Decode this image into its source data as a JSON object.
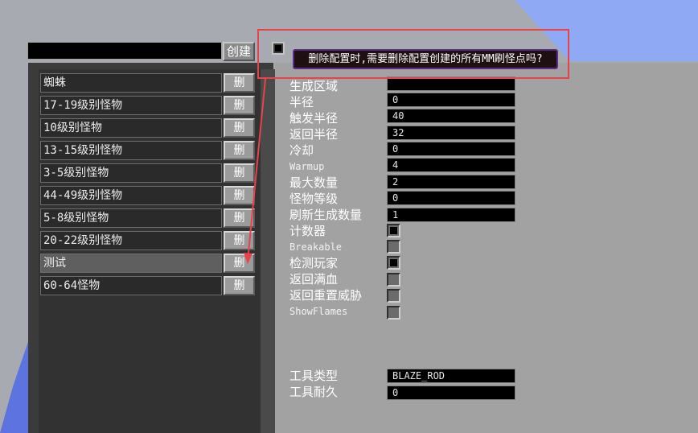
{
  "create_button": "创建",
  "name_input_value": "",
  "tooltip": "删除配置时,需要删除配置创建的所有MM刷怪点吗?",
  "delete_label": "删",
  "configs": [
    {
      "name": "蜘蛛",
      "selected": false
    },
    {
      "name": "17-19级别怪物",
      "selected": false
    },
    {
      "name": "10级别怪物",
      "selected": false
    },
    {
      "name": "13-15级别怪物",
      "selected": false
    },
    {
      "name": "3-5级别怪物",
      "selected": false
    },
    {
      "name": "44-49级别怪物",
      "selected": false
    },
    {
      "name": "5-8级别怪物",
      "selected": false
    },
    {
      "name": "20-22级别怪物",
      "selected": false
    },
    {
      "name": "测试",
      "selected": true
    },
    {
      "name": "60-64怪物",
      "selected": false
    }
  ],
  "fields": {
    "spawn_area": {
      "label": "生成区域",
      "value": ""
    },
    "radius": {
      "label": "半径",
      "value": "0"
    },
    "trigger_radius": {
      "label": "触发半径",
      "value": "40"
    },
    "return_radius": {
      "label": "返回半径",
      "value": "32"
    },
    "cooldown": {
      "label": "冷却",
      "value": "0"
    },
    "warmup": {
      "label": "Warmup",
      "value": "4"
    },
    "max_count": {
      "label": "最大数量",
      "value": "2"
    },
    "mob_level": {
      "label": "怪物等级",
      "value": "0"
    },
    "spawn_count": {
      "label": "刷新生成数量",
      "value": "1"
    },
    "counter": {
      "label": "计数器",
      "checked": true
    },
    "breakable": {
      "label": "Breakable",
      "checked": false
    },
    "detect_player": {
      "label": "检测玩家",
      "checked": true
    },
    "return_full_hp": {
      "label": "返回满血",
      "checked": false
    },
    "return_reset_threat": {
      "label": "返回重置威胁",
      "checked": false
    },
    "show_flames": {
      "label": "ShowFlames",
      "checked": false
    },
    "tool_type": {
      "label": "工具类型",
      "value": "BLAZE_ROD"
    },
    "tool_durability": {
      "label": "工具耐久",
      "value": "0"
    }
  },
  "colors": {
    "annotation": "#e8424a",
    "tooltip_border": "#5c2d86"
  }
}
